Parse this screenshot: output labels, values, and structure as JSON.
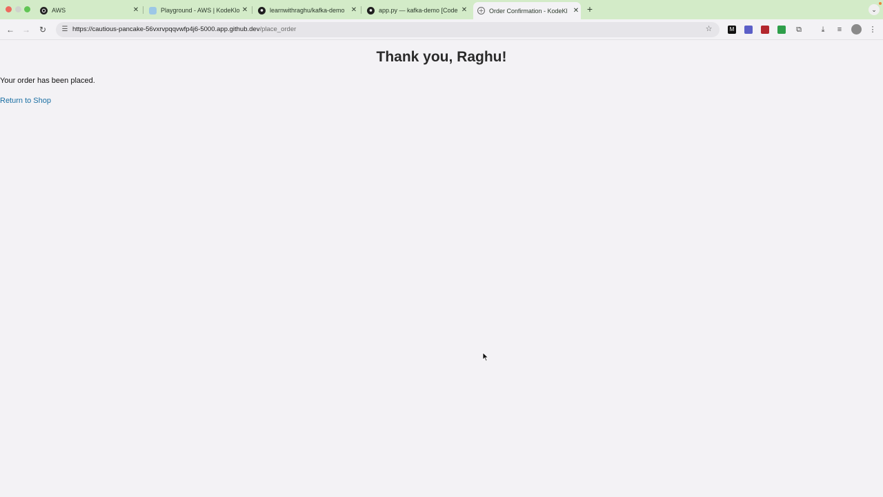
{
  "browser": {
    "tabs": [
      {
        "title": "AWS",
        "icon": "aws-icon"
      },
      {
        "title": "Playground - AWS | KodeKlou",
        "icon": "kodekloud-icon"
      },
      {
        "title": "learnwithraghu/kafka-demo",
        "icon": "github-icon"
      },
      {
        "title": "app.py — kafka-demo [Code",
        "icon": "github-icon"
      },
      {
        "title": "Order Confirmation - KodeKl",
        "icon": "globe-icon",
        "active": true
      }
    ],
    "address_bar": {
      "url_base": "https://cautious-pancake-56vxrvpqqvwfp4j6-5000.app.github.dev",
      "url_path": "/place_order"
    }
  },
  "page": {
    "heading": "Thank you, Raghu!",
    "message": "Your order has been placed.",
    "return_link": "Return to Shop"
  },
  "colors": {
    "tabstrip": "#d3ebc8",
    "page_bg": "#f3f2f5",
    "link": "#1a6fa3"
  }
}
